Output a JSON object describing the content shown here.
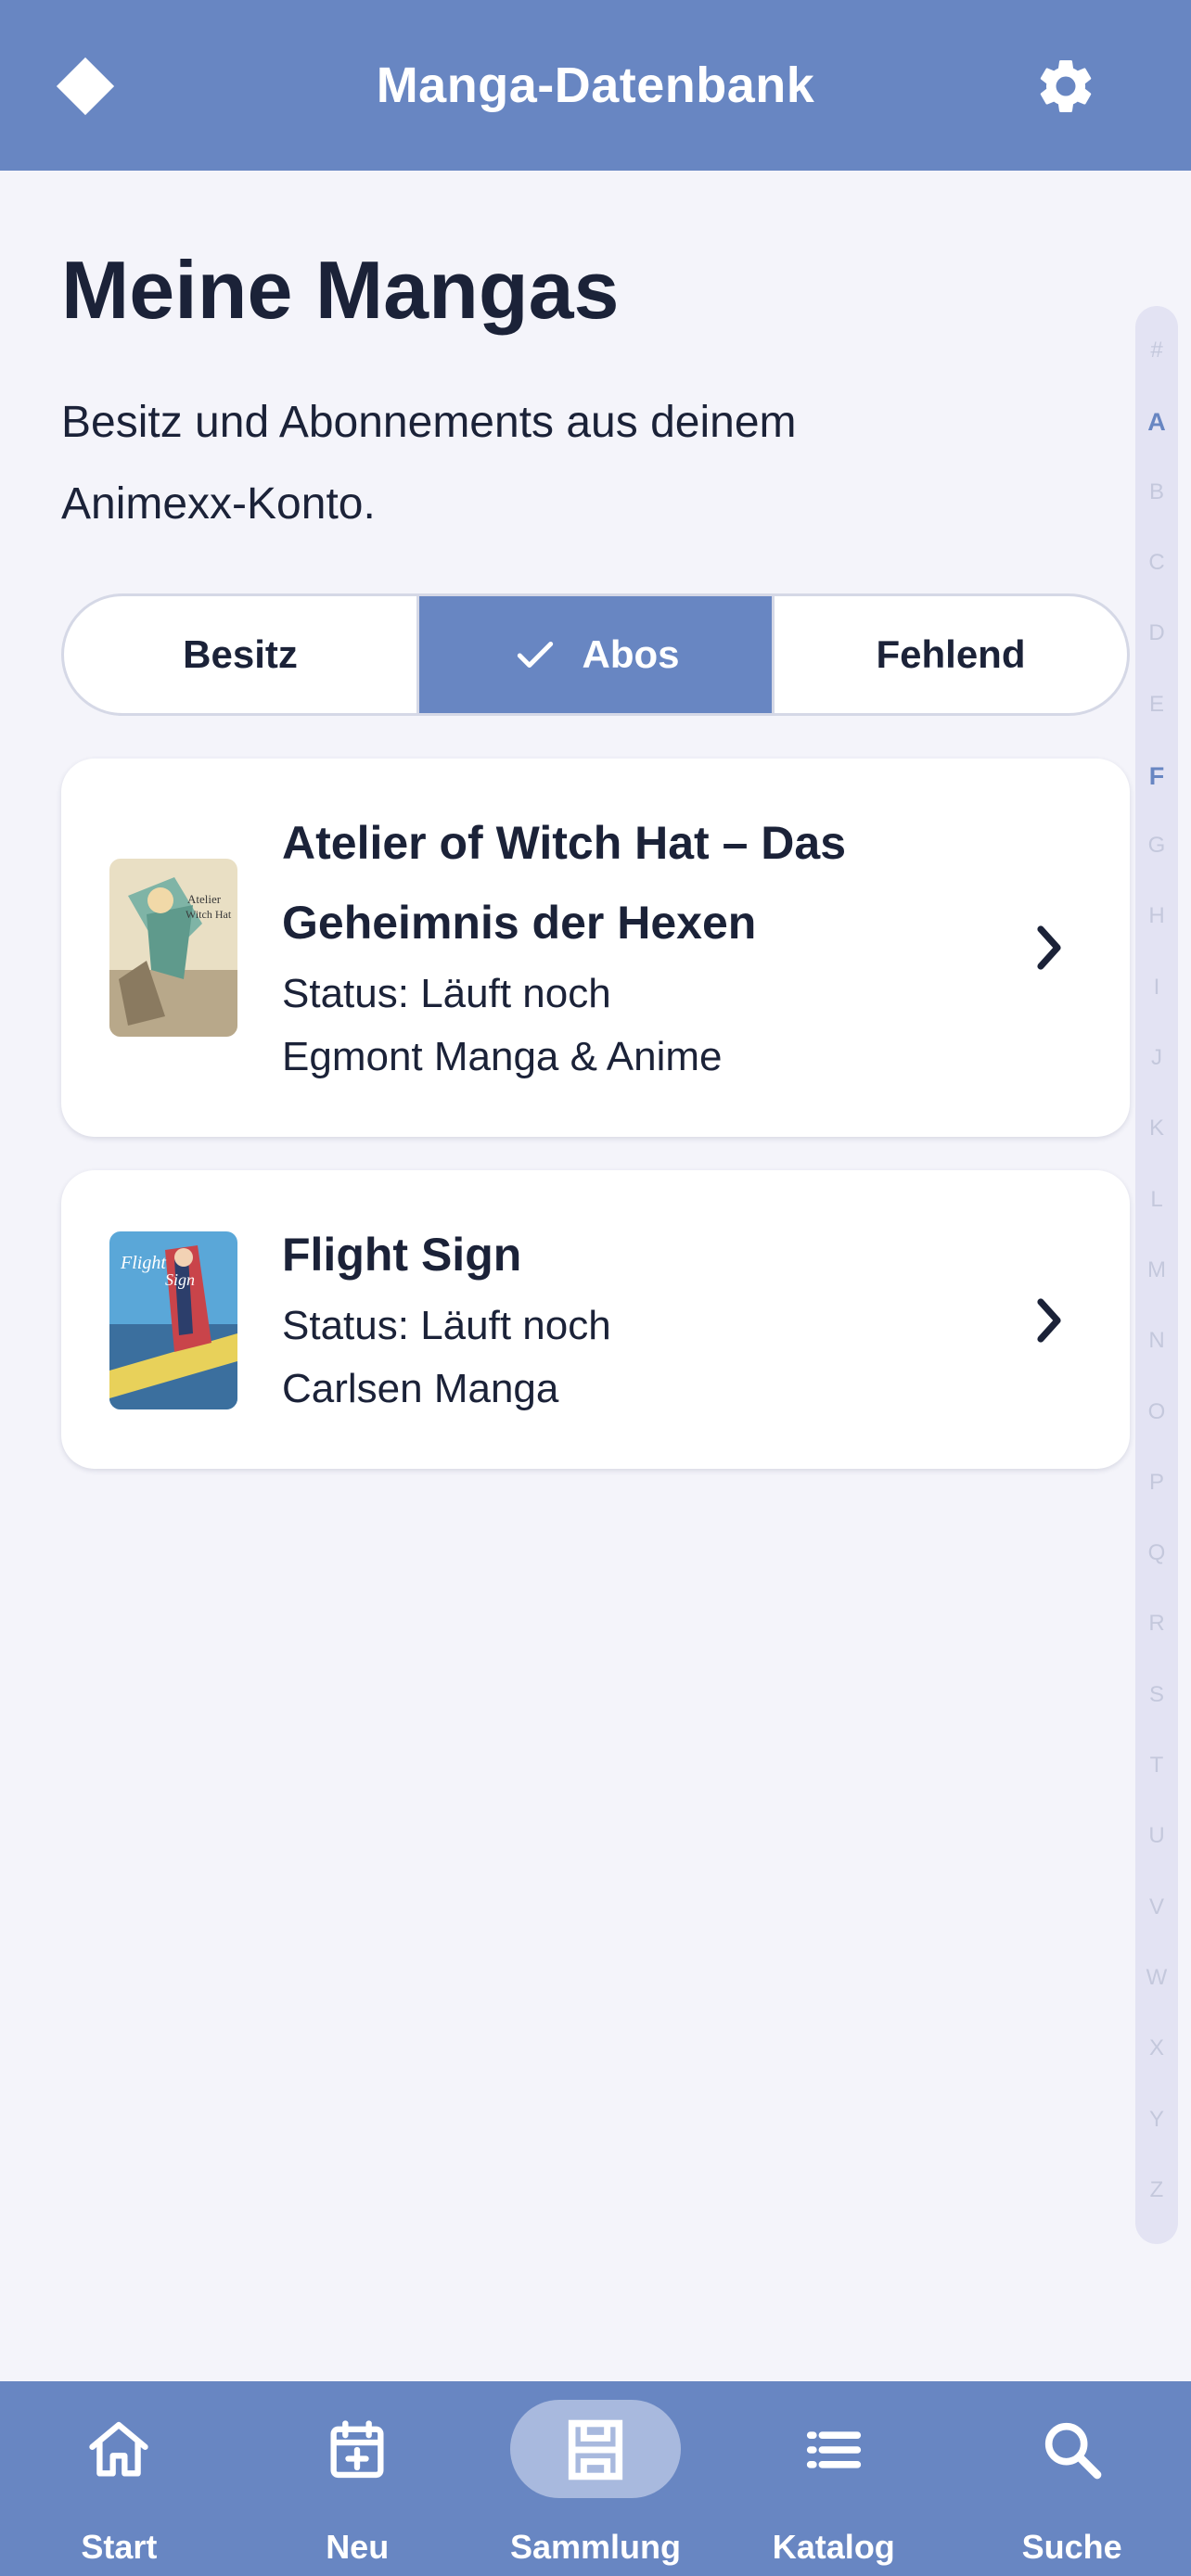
{
  "header": {
    "title": "Manga-Datenbank",
    "logo_icon": "diamond-icon",
    "settings_icon": "gear-icon"
  },
  "page": {
    "title": "Meine Mangas",
    "subtitle": "Besitz und Abonnements aus deinem Animexx-Konto."
  },
  "segments": [
    {
      "label": "Besitz",
      "selected": false
    },
    {
      "label": "Abos",
      "selected": true
    },
    {
      "label": "Fehlend",
      "selected": false
    }
  ],
  "items": [
    {
      "title": "Atelier of Witch Hat – Das Geheimnis der Hexen",
      "status": "Status: Läuft noch",
      "publisher": "Egmont Manga & Anime"
    },
    {
      "title": "Flight Sign",
      "status": "Status: Läuft noch",
      "publisher": "Carlsen Manga"
    }
  ],
  "alphabet": [
    "#",
    "A",
    "B",
    "C",
    "D",
    "E",
    "F",
    "G",
    "H",
    "I",
    "J",
    "K",
    "L",
    "M",
    "N",
    "O",
    "P",
    "Q",
    "R",
    "S",
    "T",
    "U",
    "V",
    "W",
    "X",
    "Y",
    "Z"
  ],
  "alphabet_active": [
    "A",
    "F"
  ],
  "nav": [
    {
      "label": "Start",
      "icon": "home-icon",
      "active": false
    },
    {
      "label": "Neu",
      "icon": "calendar-plus-icon",
      "active": false
    },
    {
      "label": "Sammlung",
      "icon": "shelf-icon",
      "active": true
    },
    {
      "label": "Katalog",
      "icon": "list-icon",
      "active": false
    },
    {
      "label": "Suche",
      "icon": "search-icon",
      "active": false
    }
  ],
  "colors": {
    "primary": "#6886c2",
    "background": "#f4f4fa",
    "text": "#1b2238",
    "nav_active_pill": "#a8b9de"
  }
}
